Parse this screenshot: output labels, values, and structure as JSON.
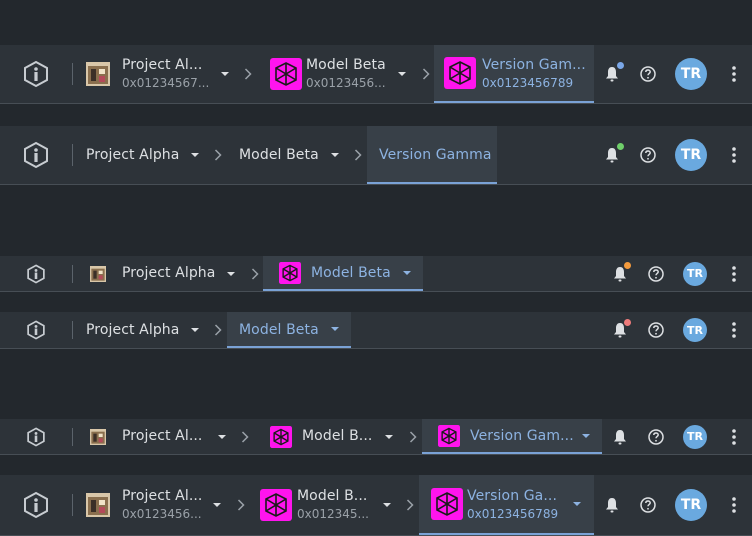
{
  "colors": {
    "background": "#23282d",
    "bar_background": "#2d3339",
    "active_background": "#384048",
    "active_accent": "#7aa2d6",
    "avatar": "#6aa9df",
    "model_thumbnail": "#ff14ee",
    "dot_blue": "#7aa7e8",
    "dot_green": "#6fcf6a",
    "dot_orange": "#f39a3d",
    "dot_red": "#ee7b7b"
  },
  "icons": {
    "logo": "info-badge-icon",
    "separator": "chevron-right-icon",
    "dropdown": "caret-down-icon",
    "notifications": "bell-icon",
    "help": "question-circle-icon",
    "menu": "more-vertical-icon",
    "project_thumbnail": "project-photo-thumbnail",
    "model_thumbnail": "model-mesh-thumbnail"
  },
  "bars": [
    {
      "crumbs": [
        {
          "title": "Project Al...",
          "subtitle": "0x01234567..."
        },
        {
          "title": "Model Beta",
          "subtitle": "0x0123456..."
        },
        {
          "title": "Version Gam...",
          "subtitle": "0x0123456789"
        }
      ],
      "avatar": "TR"
    },
    {
      "crumbs": [
        {
          "title": "Project Alpha"
        },
        {
          "title": "Model Beta"
        },
        {
          "title": "Version Gamma"
        }
      ],
      "avatar": "TR"
    },
    {
      "crumbs": [
        {
          "title": "Project Alpha"
        },
        {
          "title": "Model Beta"
        }
      ],
      "avatar": "TR"
    },
    {
      "crumbs": [
        {
          "title": "Project Alpha"
        },
        {
          "title": "Model Beta"
        }
      ],
      "avatar": "TR"
    },
    {
      "crumbs": [
        {
          "title": "Project Al..."
        },
        {
          "title": "Model B..."
        },
        {
          "title": "Version Gam..."
        }
      ],
      "avatar": "TR"
    },
    {
      "crumbs": [
        {
          "title": "Project Al...",
          "subtitle": "0x0123456..."
        },
        {
          "title": "Model B...",
          "subtitle": "0x012345..."
        },
        {
          "title": "Version Ga...",
          "subtitle": "0x0123456789"
        }
      ],
      "avatar": "TR"
    }
  ]
}
